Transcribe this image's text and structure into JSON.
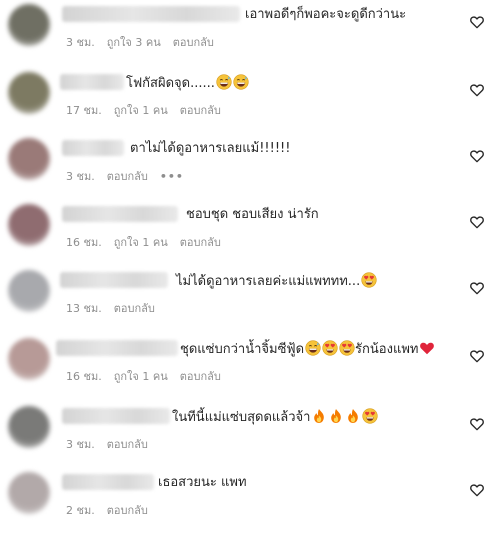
{
  "comments": [
    {
      "avatar_color": "#6f6f63",
      "text": "เอาพอดีๆก็พอคะจะดูดีกว่านะ",
      "emojis": [],
      "time": "3 ชม.",
      "likes": "ถูกใจ 3 คน",
      "reply": "ตอบกลับ",
      "more": ""
    },
    {
      "avatar_color": "#7d7a62",
      "text": "โฟกัสผิดจุด......",
      "emojis": [
        "grin-sweat",
        "grin-sweat"
      ],
      "time": "17 ชม.",
      "likes": "ถูกใจ 1 คน",
      "reply": "ตอบกลับ",
      "more": ""
    },
    {
      "avatar_color": "#9a7a78",
      "text": "ตาไม่ได้ดูอาหารเลยแม้!!!!!!",
      "emojis": [],
      "time": "3 ชม.",
      "likes": "",
      "reply": "ตอบกลับ",
      "more": "•••"
    },
    {
      "avatar_color": "#8f6c70",
      "text": "ชอบชุด ชอบเสียง น่ารัก",
      "emojis": [],
      "time": "16 ชม.",
      "likes": "ถูกใจ 1 คน",
      "reply": "ตอบกลับ",
      "more": ""
    },
    {
      "avatar_color": "#a8a9ad",
      "text": "ไม่ได้ดูอาหารเลยค่ะแม่แพททท...",
      "emojis": [
        "heart-eyes"
      ],
      "time": "13 ชม.",
      "likes": "",
      "reply": "ตอบกลับ",
      "more": ""
    },
    {
      "avatar_color": "#b79a97",
      "text": "ชุดแซ่บกว่าน้ำจิ้มซีฟู้ด",
      "emojis": [
        "grin-sweat",
        "heart-eyes",
        "heart-eyes"
      ],
      "text_after": "รักน้องแพท",
      "emojis_after": [
        "red-heart"
      ],
      "time": "16 ชม.",
      "likes": "ถูกใจ 1 คน",
      "reply": "ตอบกลับ",
      "more": ""
    },
    {
      "avatar_color": "#7a7a78",
      "text": "ในทีนี้แม่แซ่บสุดดแล้วจ้า",
      "emojis": [
        "fire",
        "fire",
        "fire",
        "heart-eyes"
      ],
      "time": "3 ชม.",
      "likes": "",
      "reply": "ตอบกลับ",
      "more": ""
    },
    {
      "avatar_color": "#b2a9a9",
      "text": "เธอสวยนะ แพท",
      "emojis": [],
      "time": "2 ชม.",
      "likes": "",
      "reply": "ตอบกลับ",
      "more": ""
    }
  ],
  "icons": {
    "like": "heart-outline-icon"
  },
  "colors": {
    "meta": "#8e8e8e",
    "text": "#262626"
  }
}
